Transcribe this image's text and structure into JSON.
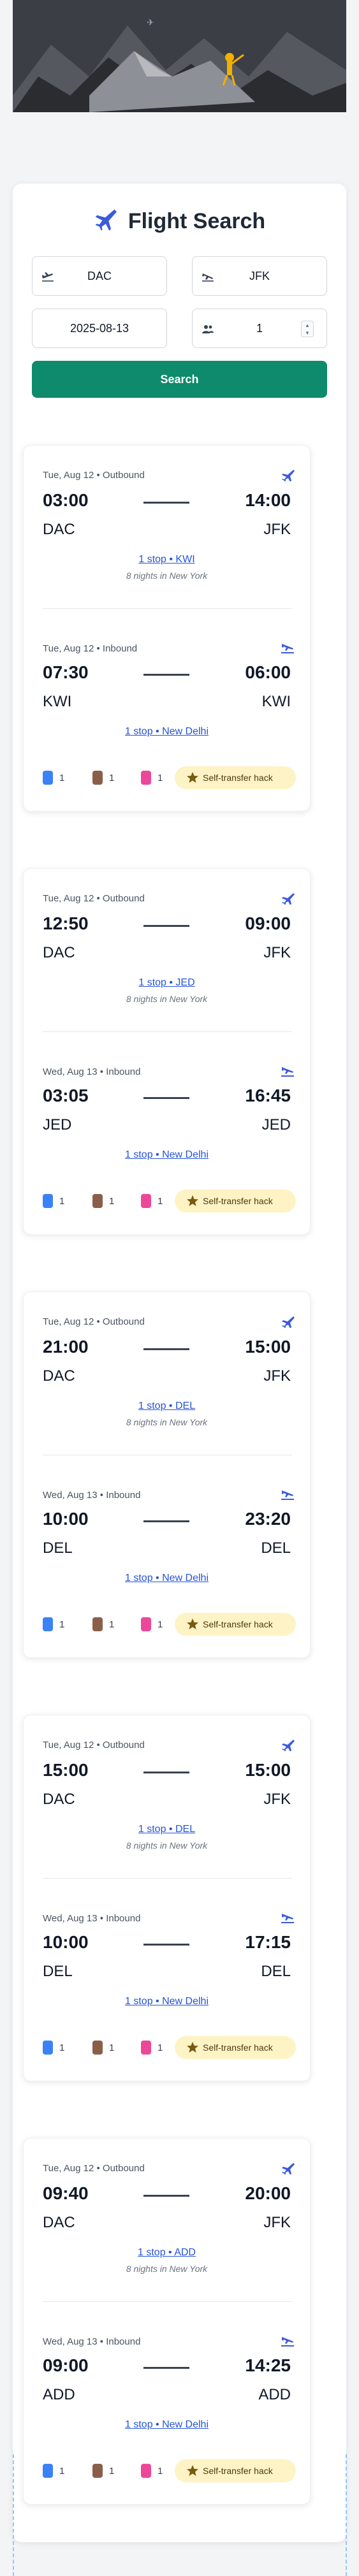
{
  "search": {
    "title": "Flight Search",
    "from": "DAC",
    "to": "JFK",
    "date": "2025-08-13",
    "passengers": "1",
    "button": "Search"
  },
  "icons": {
    "title": "airplane-icon",
    "depart": "takeoff-icon",
    "arrive": "landing-icon",
    "passengers": "people-icon",
    "bags": [
      "personal-item-icon",
      "cabin-bag-icon",
      "checked-bag-icon"
    ],
    "hack": "star-icon"
  },
  "colors": {
    "accent": "#0e8a6c",
    "link": "#2554d6",
    "hack_bg": "#fef3c4",
    "bag_blue": "#3b82f6",
    "bag_brown": "#8b5e4a",
    "bag_pink": "#ec4899"
  },
  "results": [
    {
      "outbound": {
        "label": "Tue, Aug 12 • Outbound",
        "dep_time": "03:00",
        "arr_time": "14:00",
        "from": "DAC",
        "to": "JFK",
        "stops": "1 stop • KWI",
        "nights": "8 nights in New York"
      },
      "inbound": {
        "label": "Tue, Aug 12 • Inbound",
        "dep_time": "07:30",
        "arr_time": "06:00",
        "from": "KWI",
        "to": "KWI",
        "stops": "1 stop • New Delhi"
      },
      "bags": [
        "1",
        "1",
        "1"
      ],
      "hack": "Self-transfer hack"
    },
    {
      "outbound": {
        "label": "Tue, Aug 12 • Outbound",
        "dep_time": "12:50",
        "arr_time": "09:00",
        "from": "DAC",
        "to": "JFK",
        "stops": "1 stop • JED",
        "nights": "8 nights in New York"
      },
      "inbound": {
        "label": "Wed, Aug 13 • Inbound",
        "dep_time": "03:05",
        "arr_time": "16:45",
        "from": "JED",
        "to": "JED",
        "stops": "1 stop • New Delhi"
      },
      "bags": [
        "1",
        "1",
        "1"
      ],
      "hack": "Self-transfer hack"
    },
    {
      "outbound": {
        "label": "Tue, Aug 12 • Outbound",
        "dep_time": "21:00",
        "arr_time": "15:00",
        "from": "DAC",
        "to": "JFK",
        "stops": "1 stop • DEL",
        "nights": "8 nights in New York"
      },
      "inbound": {
        "label": "Wed, Aug 13 • Inbound",
        "dep_time": "10:00",
        "arr_time": "23:20",
        "from": "DEL",
        "to": "DEL",
        "stops": "1 stop • New Delhi"
      },
      "bags": [
        "1",
        "1",
        "1"
      ],
      "hack": "Self-transfer hack"
    },
    {
      "outbound": {
        "label": "Tue, Aug 12 • Outbound",
        "dep_time": "15:00",
        "arr_time": "15:00",
        "from": "DAC",
        "to": "JFK",
        "stops": "1 stop • DEL",
        "nights": "8 nights in New York"
      },
      "inbound": {
        "label": "Wed, Aug 13 • Inbound",
        "dep_time": "10:00",
        "arr_time": "17:15",
        "from": "DEL",
        "to": "DEL",
        "stops": "1 stop • New Delhi"
      },
      "bags": [
        "1",
        "1",
        "1"
      ],
      "hack": "Self-transfer hack"
    },
    {
      "outbound": {
        "label": "Tue, Aug 12 • Outbound",
        "dep_time": "09:40",
        "arr_time": "20:00",
        "from": "DAC",
        "to": "JFK",
        "stops": "1 stop • ADD",
        "nights": "8 nights in New York"
      },
      "inbound": {
        "label": "Wed, Aug 13 • Inbound",
        "dep_time": "09:00",
        "arr_time": "14:25",
        "from": "ADD",
        "to": "ADD",
        "stops": "1 stop • New Delhi"
      },
      "bags": [
        "1",
        "1",
        "1"
      ],
      "hack": "Self-transfer hack"
    }
  ]
}
